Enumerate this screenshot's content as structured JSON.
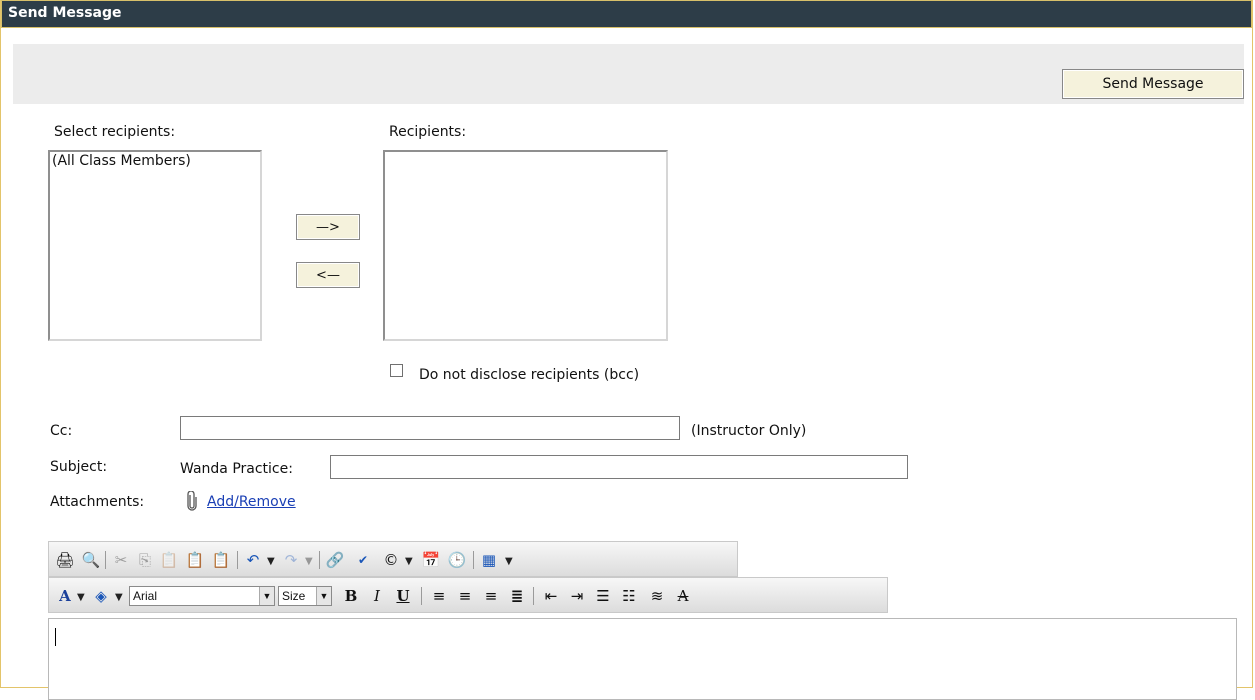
{
  "window": {
    "title": "Send Message"
  },
  "actions": {
    "send_label": "Send Message"
  },
  "recipients": {
    "select_label": "Select recipients:",
    "select_options": [
      "(All Class Members)"
    ],
    "selected_label": "Recipients:",
    "selected_options": [],
    "add_label": "—>",
    "remove_label": "<—",
    "bcc_label": "Do not disclose recipients (bcc)",
    "bcc_checked": false
  },
  "cc": {
    "label": "Cc:",
    "value": "",
    "note": "(Instructor Only)"
  },
  "subject": {
    "label": "Subject:",
    "prefix": "Wanda Practice:",
    "value": ""
  },
  "attachments": {
    "label": "Attachments:",
    "link": "Add/Remove"
  },
  "toolbar": {
    "font_name": "Arial",
    "font_size": "Size",
    "row1_icons": [
      "print-icon",
      "find-icon",
      "cut-icon",
      "copy-icon",
      "paste-icon",
      "paste-text-icon",
      "paste-word-icon",
      "undo-icon",
      "redo-icon",
      "hyperlink-icon",
      "spellcheck-icon",
      "special-char-icon",
      "insert-date-icon",
      "insert-time-icon",
      "table-icon"
    ],
    "row2_icons": [
      "font-color-icon",
      "highlight-icon",
      "bold-icon",
      "italic-icon",
      "underline-icon",
      "align-left-icon",
      "align-center-icon",
      "align-right-icon",
      "justify-icon",
      "outdent-icon",
      "indent-icon",
      "numbered-list-icon",
      "bullet-list-icon",
      "line-spacing-icon",
      "strikethrough-icon"
    ]
  },
  "editor": {
    "value": ""
  }
}
